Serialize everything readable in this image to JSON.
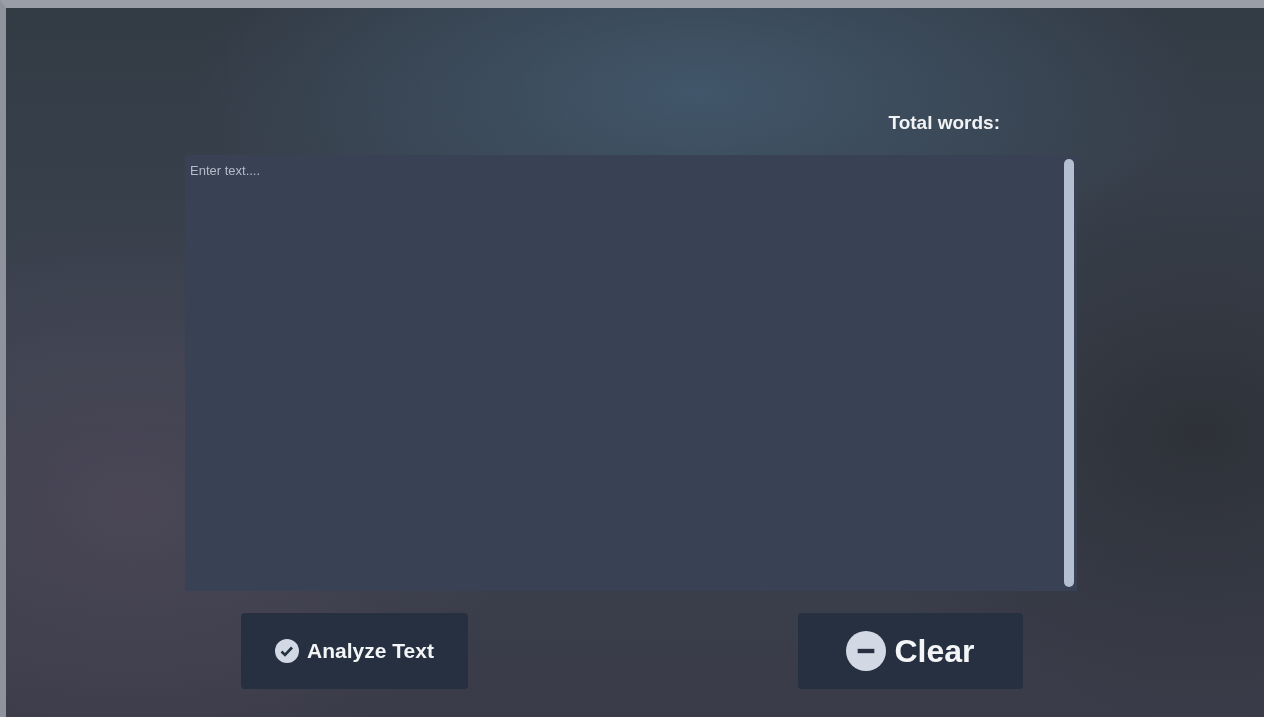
{
  "total_words": {
    "label": "Total words:"
  },
  "text_input": {
    "placeholder": "Enter text...."
  },
  "buttons": [
    {
      "label": "Analyze Text",
      "kind": "check"
    },
    {
      "label": "Clear",
      "kind": "minus"
    }
  ]
}
